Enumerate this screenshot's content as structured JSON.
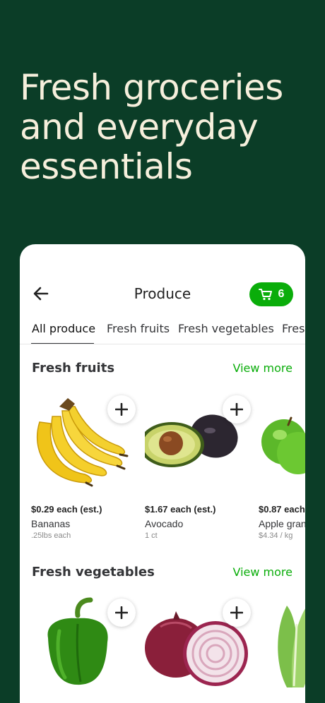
{
  "hero": {
    "headline": "Fresh groceries and everyday essentials"
  },
  "header": {
    "title": "Produce",
    "cart_count": "6"
  },
  "tabs": [
    {
      "label": "All produce"
    },
    {
      "label": "Fresh fruits"
    },
    {
      "label": "Fresh vegetables"
    },
    {
      "label": "Fres"
    }
  ],
  "fruits": {
    "title": "Fresh fruits",
    "view_more": "View more",
    "items": [
      {
        "price": "$0.29 each (est.)",
        "name": "Bananas",
        "sub": ".25lbs each"
      },
      {
        "price": "$1.67 each (est.)",
        "name": "Avocado",
        "sub": "1 ct"
      },
      {
        "price": "$0.87 each",
        "name": "Apple gran",
        "sub": "$4.34 / kg"
      }
    ]
  },
  "vegetables": {
    "title": "Fresh vegetables",
    "view_more": "View more"
  },
  "colors": {
    "background": "#0b3d27",
    "accent": "#0aad0a",
    "hero_text": "#f6efdc"
  }
}
